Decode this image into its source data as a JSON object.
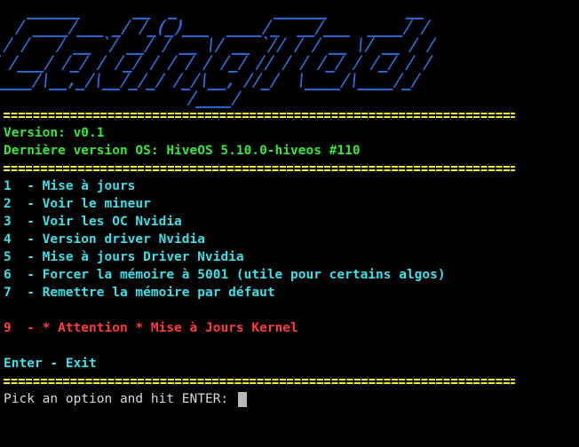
{
  "banner": {
    "art": "   ______      __  _           ______         __ \n  / ____/___ _/ /_(_)___  ____/_  __/___  ____/ / \n / /   / __ `/ __/ / __ \\/ __ `// / / __ \\/ __ / / \n/ /___/ /_/ / /_/ / / / / /_/ // / / /_/ / /_/ / /  \n\\____/\\__,_/\\__/_/_/ /_/\\__, //_/  \\____/\\____/_/   \n                       /____/                       "
  },
  "separator": "=================================================================",
  "version_label": "Version: v0.1",
  "os_label": "Dernière version OS: HiveOS 5.10.0-hiveos #110",
  "menu": [
    {
      "num": "1",
      "label": "Mise à jours"
    },
    {
      "num": "2",
      "label": "Voir le mineur"
    },
    {
      "num": "3",
      "label": "Voir les OC Nvidia"
    },
    {
      "num": "4",
      "label": "Version driver Nvidia"
    },
    {
      "num": "5",
      "label": "Mise à jours Driver Nvidia"
    },
    {
      "num": "6",
      "label": "Forcer la mémoire à 5001 (utile pour certains algos)"
    },
    {
      "num": "7",
      "label": "Remettre la mémoire par défaut"
    }
  ],
  "warning_item": {
    "num": "9",
    "label": "* Attention * Mise à Jours Kernel"
  },
  "exit_label": "Enter - Exit",
  "prompt_label": "Pick an option and hit ENTER: ",
  "colors": {
    "banner": "#2f6fe0",
    "separator": "#f2e830",
    "info": "#39e63a",
    "menu": "#3de0e8",
    "warning": "#ff3b3b",
    "prompt": "#d8d8d8"
  }
}
